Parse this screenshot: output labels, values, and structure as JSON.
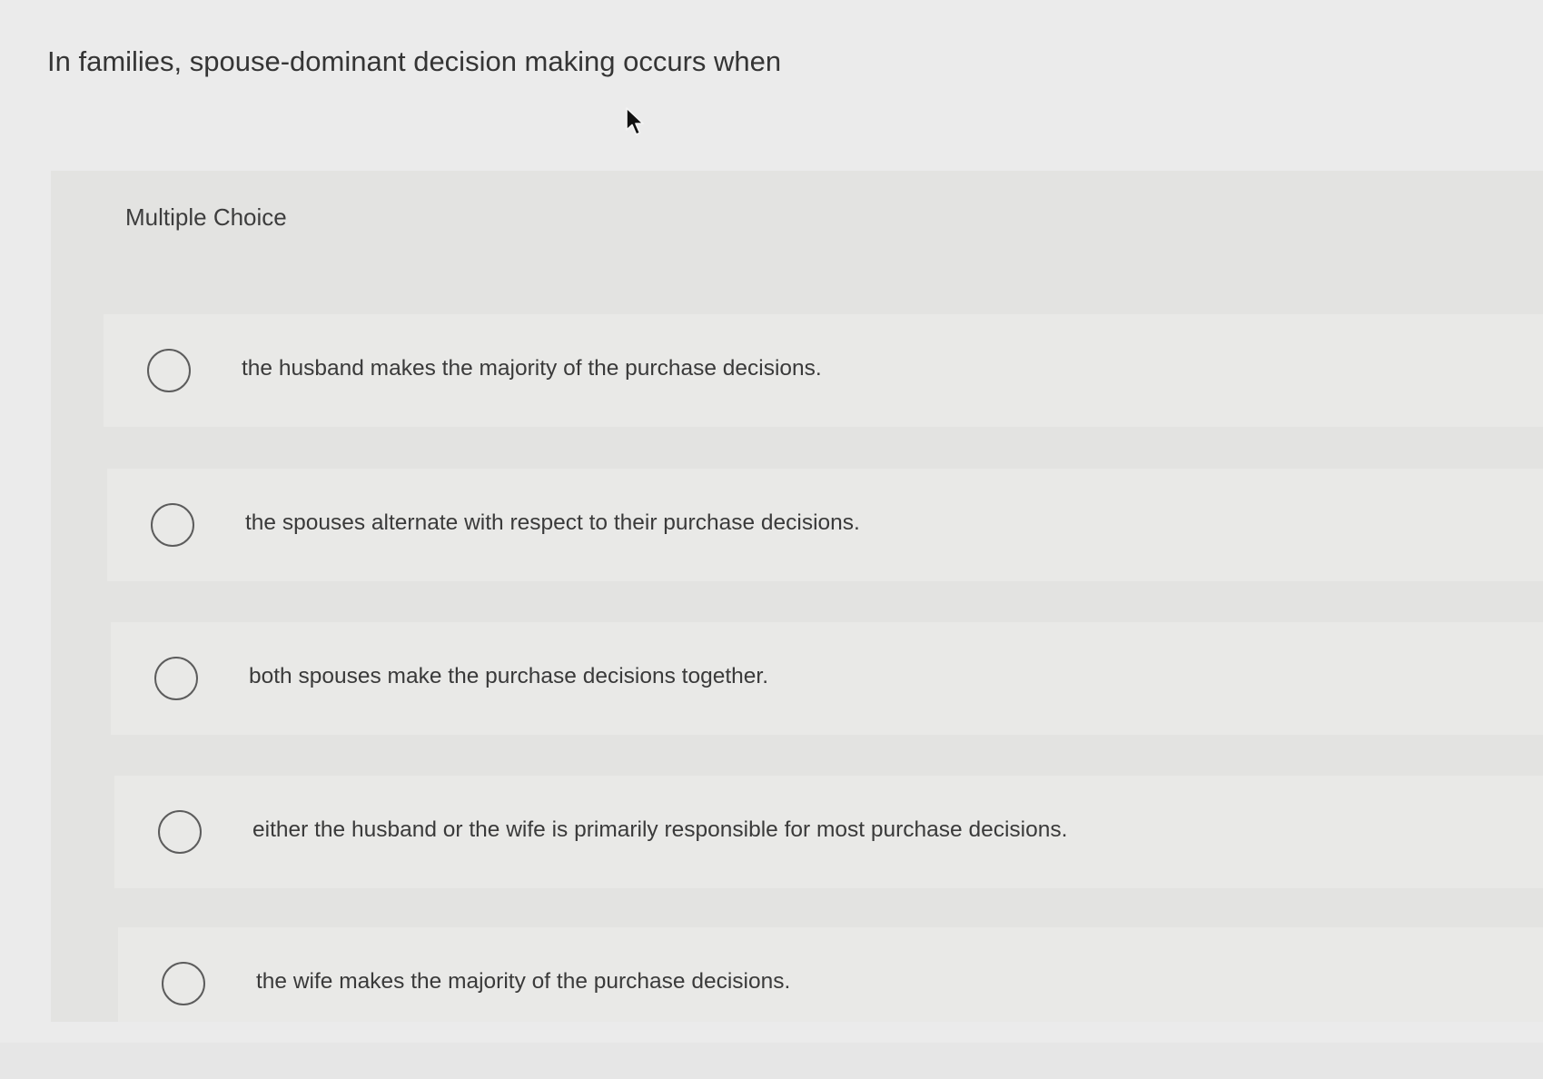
{
  "question": {
    "text": "In families, spouse-dominant decision making occurs when"
  },
  "panel": {
    "label": "Multiple Choice"
  },
  "choices": [
    {
      "text": "the husband makes the majority of the purchase decisions.",
      "selected": false
    },
    {
      "text": "the spouses alternate with respect to their purchase decisions.",
      "selected": false
    },
    {
      "text": "both spouses make the purchase decisions together.",
      "selected": false
    },
    {
      "text": "either the husband or the wife is primarily responsible for most purchase decisions.",
      "selected": false
    },
    {
      "text": "the wife makes the majority of the purchase decisions.",
      "selected": false
    }
  ],
  "icons": {
    "cursor": "mouse-pointer-icon",
    "radio": "radio-button-unchecked-icon"
  },
  "colors": {
    "background": "#ebebeb",
    "panel": "#e3e3e1",
    "choice_row": "#e9e9e7",
    "text": "#3a3a3a",
    "radio_border": "#5c5c5c"
  }
}
